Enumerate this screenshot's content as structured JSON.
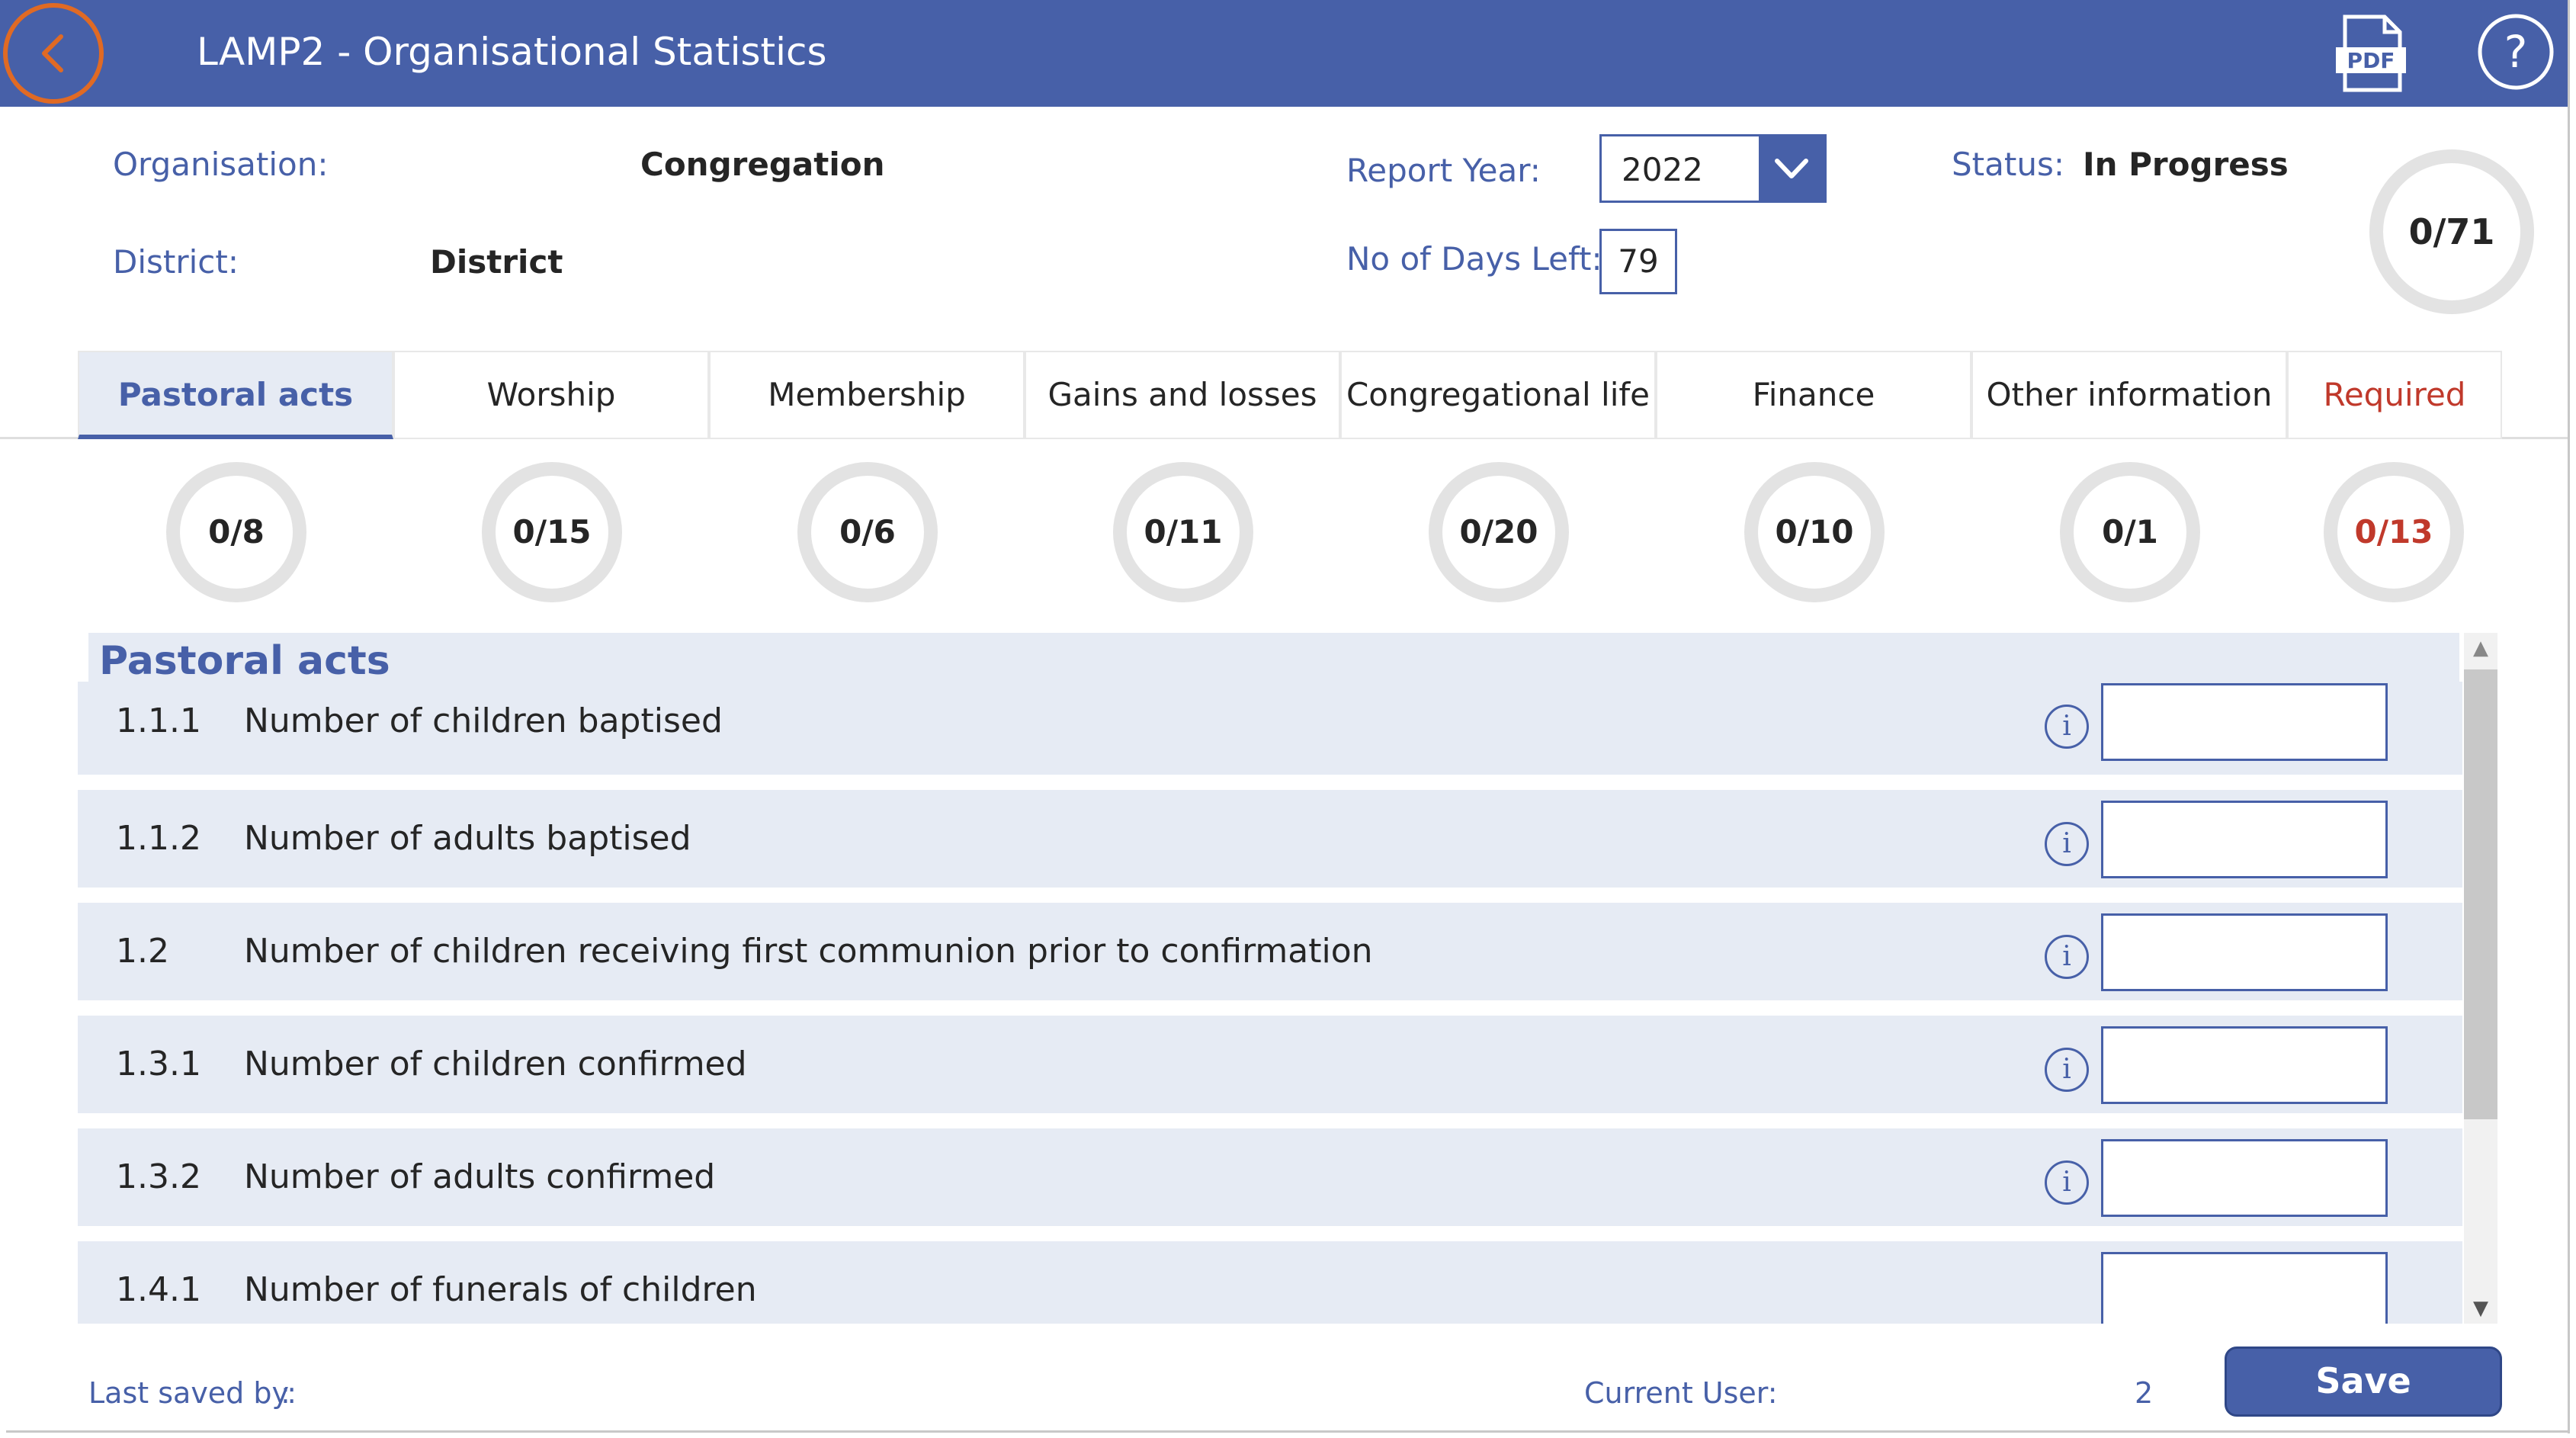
{
  "header": {
    "title": "LAMP2 - Organisational Statistics",
    "back_icon": "chevron-left-icon",
    "pdf_label": "PDF",
    "help_label": "?"
  },
  "info": {
    "organisation_label": "Organisation:",
    "organisation_value": "Congregation",
    "district_label": "District:",
    "district_value": "District",
    "report_year_label": "Report Year:",
    "report_year_value": "2022",
    "days_left_label": "No of Days Left:",
    "days_left_value": "79",
    "status_label": "Status:",
    "status_value": "In Progress",
    "overall_progress": "0/71"
  },
  "tabs": [
    {
      "label": "Pastoral acts",
      "progress": "0/8"
    },
    {
      "label": "Worship",
      "progress": "0/15"
    },
    {
      "label": "Membership",
      "progress": "0/6"
    },
    {
      "label": "Gains and losses",
      "progress": "0/11"
    },
    {
      "label": "Congregational life",
      "progress": "0/20"
    },
    {
      "label": "Finance",
      "progress": "0/10"
    },
    {
      "label": "Other information",
      "progress": "0/1"
    },
    {
      "label": "Required",
      "progress": "0/13"
    }
  ],
  "section": {
    "title": "Pastoral acts",
    "rows": [
      {
        "code": "1.1.1",
        "text": "Number of children baptised",
        "value": ""
      },
      {
        "code": "1.1.2",
        "text": "Number of adults baptised",
        "value": ""
      },
      {
        "code": "1.2",
        "text": "Number of children receiving first communion prior to confirmation",
        "value": ""
      },
      {
        "code": "1.3.1",
        "text": "Number of children confirmed",
        "value": ""
      },
      {
        "code": "1.3.2",
        "text": "Number of adults confirmed",
        "value": ""
      },
      {
        "code": "1.4.1",
        "text": "Number of funerals of children",
        "value": ""
      }
    ],
    "info_glyph": "i"
  },
  "footer": {
    "last_saved_label": "Last saved by:",
    "last_saved_value": ":",
    "current_user_label": "Current User:",
    "current_user_value": "2",
    "save_label": "Save"
  },
  "colors": {
    "brand": "#4760a8",
    "accent_back": "#e06a24",
    "required": "#c0392b",
    "row_bg": "#e6ebf4"
  }
}
